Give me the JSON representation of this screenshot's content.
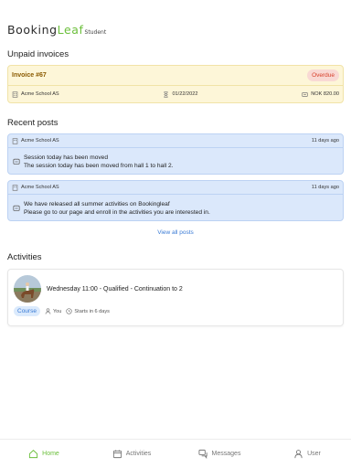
{
  "brand": {
    "name_main": "Booking",
    "name_accent": "Leaf",
    "subtitle": "Student"
  },
  "unpaid": {
    "title": "Unpaid invoices",
    "invoice": {
      "title": "Invoice #67",
      "status": "Overdue",
      "school": "Acme School AS",
      "due_date": "01/22/2022",
      "amount": "NOK 820.00"
    }
  },
  "recent": {
    "title": "Recent posts",
    "posts": [
      {
        "author": "Acme School AS",
        "time": "11 days ago",
        "line1": "Session today has been moved",
        "line2": "The session today has been moved from hall 1 to hall 2."
      },
      {
        "author": "Acme School AS",
        "time": "11 days ago",
        "line1": "We have released all summer activities on Bookingleaf",
        "line2": "Please go to our page and enroll in the activities you are interested in."
      }
    ],
    "view_all": "View all posts"
  },
  "activities": {
    "title": "Activities",
    "item": {
      "title": "Wednesday 11:00 - Qualified - Continuation to 2",
      "badge": "Course",
      "participant": "You",
      "starts": "Starts in 6 days"
    }
  },
  "nav": {
    "home": "Home",
    "activities": "Activities",
    "messages": "Messages",
    "user": "User"
  },
  "colors": {
    "accent": "#6bbf3b",
    "link": "#3a7bd5",
    "overdue": "#d7402b",
    "invoice_bg": "#fdf6d8",
    "post_bg": "#dbe8fb"
  }
}
